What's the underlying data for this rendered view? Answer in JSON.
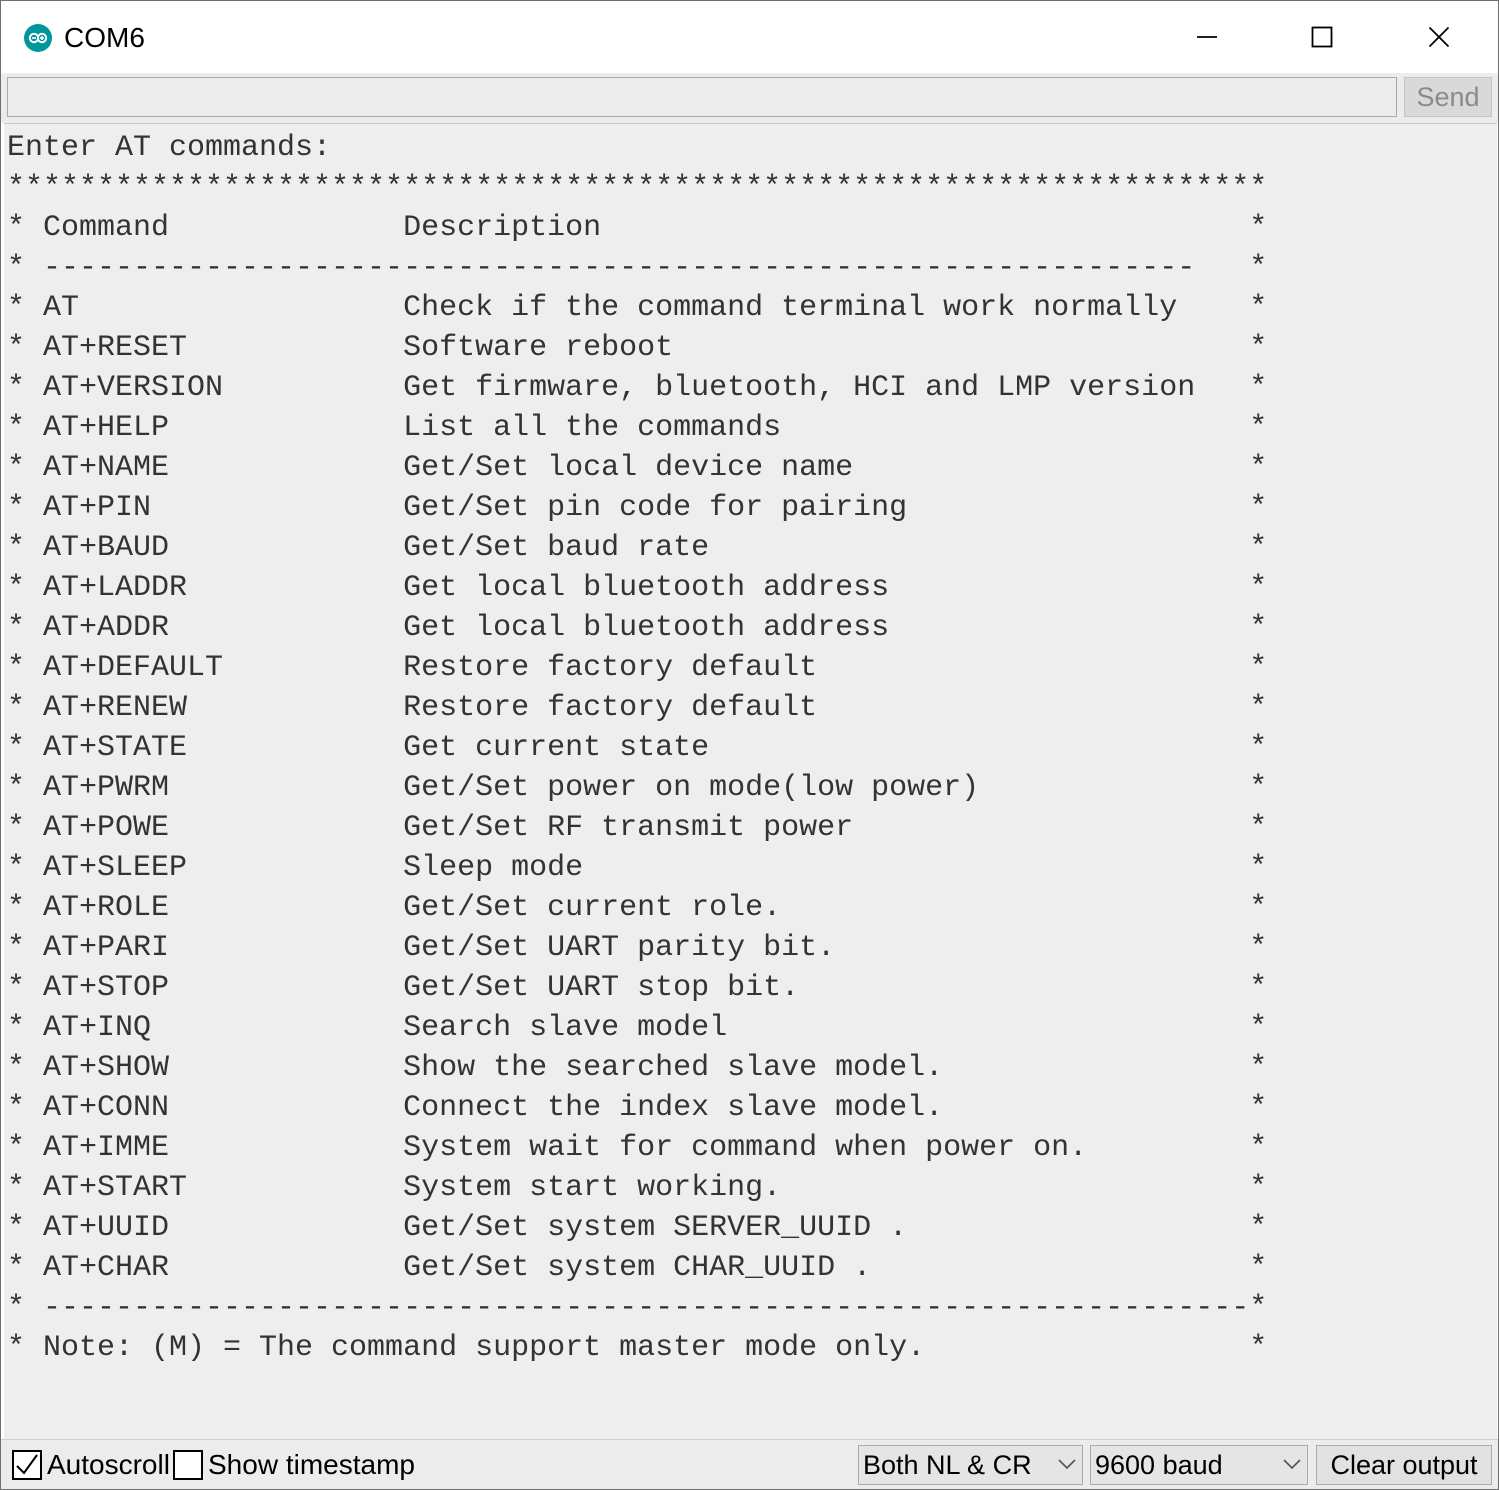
{
  "window": {
    "title": "COM6"
  },
  "send_bar": {
    "input_value": "",
    "send_label": "Send"
  },
  "output": {
    "lines": [
      "Enter AT commands:",
      "**********************************************************************",
      "* Command             Description                                    *",
      "* ----------------------------------------------------------------   *",
      "* AT                  Check if the command terminal work normally    *",
      "* AT+RESET            Software reboot                                *",
      "* AT+VERSION          Get firmware, bluetooth, HCI and LMP version   *",
      "* AT+HELP             List all the commands                          *",
      "* AT+NAME             Get/Set local device name                      *",
      "* AT+PIN              Get/Set pin code for pairing                   *",
      "* AT+BAUD             Get/Set baud rate                              *",
      "* AT+LADDR            Get local bluetooth address                    *",
      "* AT+ADDR             Get local bluetooth address                    *",
      "* AT+DEFAULT          Restore factory default                        *",
      "* AT+RENEW            Restore factory default                        *",
      "* AT+STATE            Get current state                              *",
      "* AT+PWRM             Get/Set power on mode(low power)               *",
      "* AT+POWE             Get/Set RF transmit power                      *",
      "* AT+SLEEP            Sleep mode                                     *",
      "* AT+ROLE             Get/Set current role.                          *",
      "* AT+PARI             Get/Set UART parity bit.                       *",
      "* AT+STOP             Get/Set UART stop bit.                         *",
      "* AT+INQ              Search slave model                             *",
      "* AT+SHOW             Show the searched slave model.                 *",
      "* AT+CONN             Connect the index slave model.                 *",
      "* AT+IMME             System wait for command when power on.         *",
      "* AT+START            System start working.                          *",
      "* AT+UUID             Get/Set system SERVER_UUID .                   *",
      "* AT+CHAR             Get/Set system CHAR_UUID .                     *",
      "* -------------------------------------------------------------------*",
      "* Note: (M) = The command support master mode only.                  *"
    ]
  },
  "bottom_bar": {
    "autoscroll_label": "Autoscroll",
    "autoscroll_checked": true,
    "timestamp_label": "Show timestamp",
    "timestamp_checked": false,
    "line_ending": "Both NL & CR",
    "baud_rate": "9600 baud",
    "clear_label": "Clear output"
  },
  "colors": {
    "accent_icon": "#00979c",
    "output_background": "#eeeeee",
    "output_text": "#333333"
  }
}
